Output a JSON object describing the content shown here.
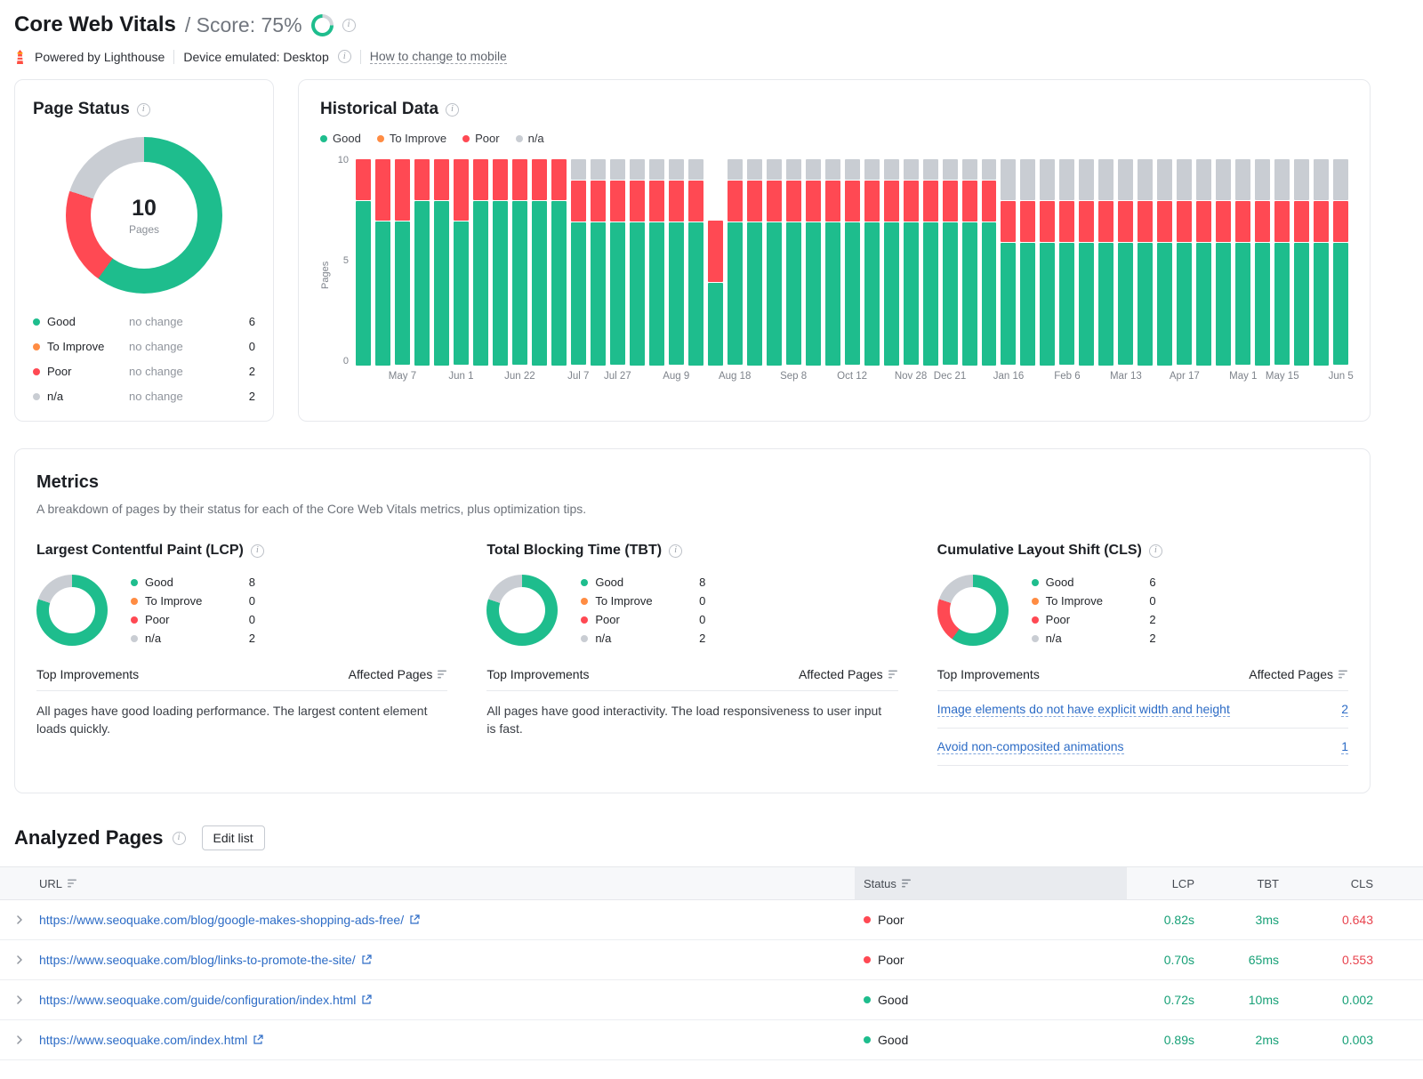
{
  "header": {
    "title": "Core Web Vitals",
    "score_label": "/ Score: 75%",
    "score_percent": 75,
    "powered_by": "Powered by Lighthouse",
    "device": "Device emulated: Desktop",
    "mobile_link": "How to change to mobile"
  },
  "colors": {
    "good": "#1ebd8d",
    "to_improve": "#ff8c43",
    "poor": "#ff4953",
    "na": "#c9cdd3",
    "ring_rest": "#d3d6db",
    "link": "#2d6cc6",
    "value_good": "#17a077",
    "value_poor": "#e8434e"
  },
  "page_status": {
    "title": "Page Status",
    "total": "10",
    "total_label": "Pages",
    "legend": [
      {
        "key": "good",
        "label": "Good",
        "change": "no change",
        "count": 6
      },
      {
        "key": "to_improve",
        "label": "To Improve",
        "change": "no change",
        "count": 0
      },
      {
        "key": "poor",
        "label": "Poor",
        "change": "no change",
        "count": 2
      },
      {
        "key": "na",
        "label": "n/a",
        "change": "no change",
        "count": 2
      }
    ]
  },
  "historical": {
    "title": "Historical Data",
    "legend": [
      {
        "key": "good",
        "label": "Good"
      },
      {
        "key": "to_improve",
        "label": "To Improve"
      },
      {
        "key": "poor",
        "label": "Poor"
      },
      {
        "key": "na",
        "label": "n/a"
      }
    ]
  },
  "chart_data": {
    "type": "bar",
    "stacked": true,
    "title": "Historical Data",
    "ylabel": "Pages",
    "ylim": [
      0,
      10
    ],
    "yticks": [
      0,
      5,
      10
    ],
    "series_order": [
      "good",
      "to_improve",
      "poor",
      "na"
    ],
    "bars": [
      [
        8,
        0,
        2,
        0
      ],
      [
        7,
        0,
        3,
        0
      ],
      [
        7,
        0,
        3,
        0
      ],
      [
        8,
        0,
        2,
        0
      ],
      [
        8,
        0,
        2,
        0
      ],
      [
        7,
        0,
        3,
        0
      ],
      [
        8,
        0,
        2,
        0
      ],
      [
        8,
        0,
        2,
        0
      ],
      [
        8,
        0,
        2,
        0
      ],
      [
        8,
        0,
        2,
        0
      ],
      [
        8,
        0,
        2,
        0
      ],
      [
        7,
        0,
        2,
        1
      ],
      [
        7,
        0,
        2,
        1
      ],
      [
        7,
        0,
        2,
        1
      ],
      [
        7,
        0,
        2,
        1
      ],
      [
        7,
        0,
        2,
        1
      ],
      [
        7,
        0,
        2,
        1
      ],
      [
        7,
        0,
        2,
        1
      ],
      [
        4,
        0,
        3,
        0
      ],
      [
        7,
        0,
        2,
        1
      ],
      [
        7,
        0,
        2,
        1
      ],
      [
        7,
        0,
        2,
        1
      ],
      [
        7,
        0,
        2,
        1
      ],
      [
        7,
        0,
        2,
        1
      ],
      [
        7,
        0,
        2,
        1
      ],
      [
        7,
        0,
        2,
        1
      ],
      [
        7,
        0,
        2,
        1
      ],
      [
        7,
        0,
        2,
        1
      ],
      [
        7,
        0,
        2,
        1
      ],
      [
        7,
        0,
        2,
        1
      ],
      [
        7,
        0,
        2,
        1
      ],
      [
        7,
        0,
        2,
        1
      ],
      [
        7,
        0,
        2,
        1
      ],
      [
        6,
        0,
        2,
        2
      ],
      [
        6,
        0,
        2,
        2
      ],
      [
        6,
        0,
        2,
        2
      ],
      [
        6,
        0,
        2,
        2
      ],
      [
        6,
        0,
        2,
        2
      ],
      [
        6,
        0,
        2,
        2
      ],
      [
        6,
        0,
        2,
        2
      ],
      [
        6,
        0,
        2,
        2
      ],
      [
        6,
        0,
        2,
        2
      ],
      [
        6,
        0,
        2,
        2
      ],
      [
        6,
        0,
        2,
        2
      ],
      [
        6,
        0,
        2,
        2
      ],
      [
        6,
        0,
        2,
        2
      ],
      [
        6,
        0,
        2,
        2
      ],
      [
        6,
        0,
        2,
        2
      ],
      [
        6,
        0,
        2,
        2
      ],
      [
        6,
        0,
        2,
        2
      ],
      [
        6,
        0,
        2,
        2
      ]
    ],
    "tick_labels": [
      [
        2,
        "May 7"
      ],
      [
        5,
        "Jun 1"
      ],
      [
        8,
        "Jun 22"
      ],
      [
        11,
        "Jul 7"
      ],
      [
        13,
        "Jul 27"
      ],
      [
        16,
        "Aug 9"
      ],
      [
        19,
        "Aug 18"
      ],
      [
        22,
        "Sep 8"
      ],
      [
        25,
        "Oct 12"
      ],
      [
        28,
        "Nov 28"
      ],
      [
        30,
        "Dec 21"
      ],
      [
        33,
        "Jan 16"
      ],
      [
        36,
        "Feb 6"
      ],
      [
        39,
        "Mar 13"
      ],
      [
        42,
        "Apr 17"
      ],
      [
        45,
        "May 1"
      ],
      [
        47,
        "May 15"
      ],
      [
        50,
        "Jun 5"
      ]
    ]
  },
  "metrics": {
    "title": "Metrics",
    "subtitle": "A breakdown of pages by their status for each of the Core Web Vitals metrics, plus optimization tips.",
    "improvements_header": "Top Improvements",
    "affected_header": "Affected Pages",
    "panels": [
      {
        "id": "lcp",
        "title": "Largest Contentful Paint (LCP)",
        "legend": [
          {
            "key": "good",
            "label": "Good",
            "count": 8
          },
          {
            "key": "to_improve",
            "label": "To Improve",
            "count": 0
          },
          {
            "key": "poor",
            "label": "Poor",
            "count": 0
          },
          {
            "key": "na",
            "label": "n/a",
            "count": 2
          }
        ],
        "note": "All pages have good loading performance. The largest content element loads quickly."
      },
      {
        "id": "tbt",
        "title": "Total Blocking Time (TBT)",
        "legend": [
          {
            "key": "good",
            "label": "Good",
            "count": 8
          },
          {
            "key": "to_improve",
            "label": "To Improve",
            "count": 0
          },
          {
            "key": "poor",
            "label": "Poor",
            "count": 0
          },
          {
            "key": "na",
            "label": "n/a",
            "count": 2
          }
        ],
        "note": "All pages have good interactivity. The load responsiveness to user input is fast."
      },
      {
        "id": "cls",
        "title": "Cumulative Layout Shift (CLS)",
        "legend": [
          {
            "key": "good",
            "label": "Good",
            "count": 6
          },
          {
            "key": "to_improve",
            "label": "To Improve",
            "count": 0
          },
          {
            "key": "poor",
            "label": "Poor",
            "count": 2
          },
          {
            "key": "na",
            "label": "n/a",
            "count": 2
          }
        ],
        "improvements": [
          {
            "label": "Image elements do not have explicit width and height",
            "count": "2"
          },
          {
            "label": "Avoid non-composited animations",
            "count": "1"
          }
        ]
      }
    ]
  },
  "analyzed": {
    "title": "Analyzed Pages",
    "edit_button": "Edit list",
    "columns": {
      "url": "URL",
      "status": "Status",
      "lcp": "LCP",
      "tbt": "TBT",
      "cls": "CLS"
    },
    "rows": [
      {
        "url": "https://www.seoquake.com/blog/google-makes-shopping-ads-free/",
        "status": "Poor",
        "lcp": "0.82s",
        "tbt": "3ms",
        "cls": "0.643",
        "cls_status": "poor"
      },
      {
        "url": "https://www.seoquake.com/blog/links-to-promote-the-site/",
        "status": "Poor",
        "lcp": "0.70s",
        "tbt": "65ms",
        "cls": "0.553",
        "cls_status": "poor"
      },
      {
        "url": "https://www.seoquake.com/guide/configuration/index.html",
        "status": "Good",
        "lcp": "0.72s",
        "tbt": "10ms",
        "cls": "0.002",
        "cls_status": "good"
      },
      {
        "url": "https://www.seoquake.com/index.html",
        "status": "Good",
        "lcp": "0.89s",
        "tbt": "2ms",
        "cls": "0.003",
        "cls_status": "good"
      }
    ]
  }
}
